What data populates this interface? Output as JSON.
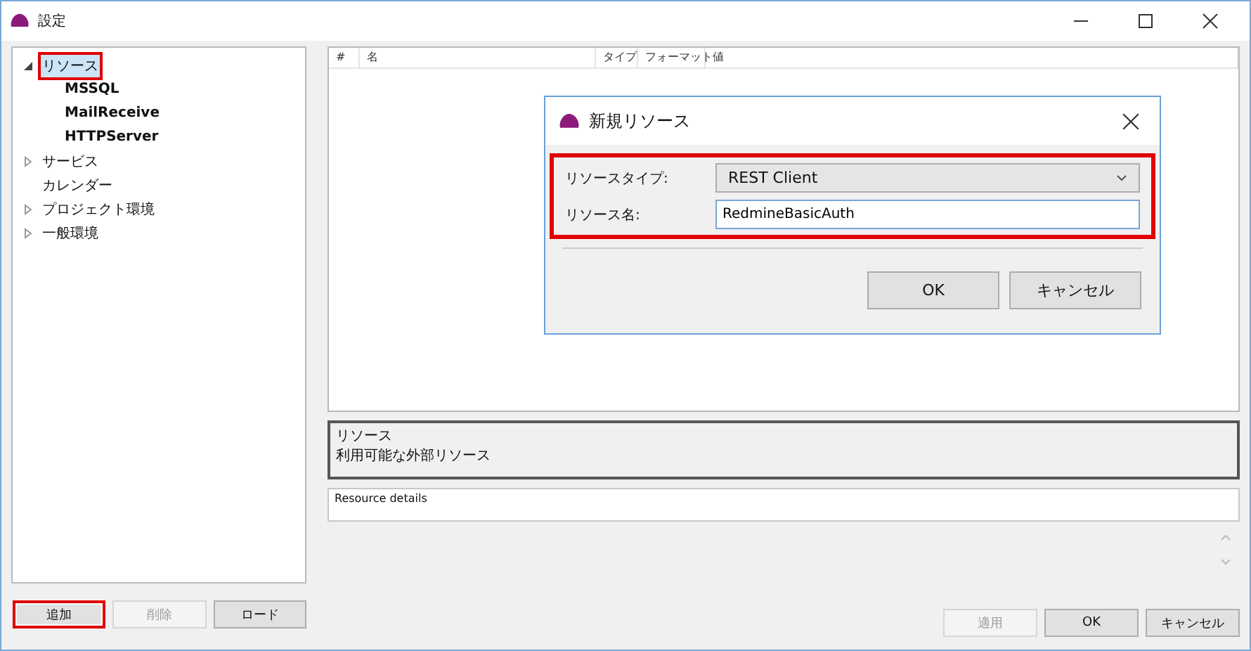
{
  "window": {
    "title": "設定"
  },
  "tree": [
    {
      "label": "リソース",
      "expanded": true,
      "selected": true,
      "highlighted": true,
      "children": [
        {
          "label": "MSSQL"
        },
        {
          "label": "MailReceive"
        },
        {
          "label": "HTTPServer"
        }
      ]
    },
    {
      "label": "サービス",
      "expanded": false,
      "selected": false,
      "highlighted": false
    },
    {
      "label": "カレンダー",
      "selected": false,
      "highlighted": false
    },
    {
      "label": "プロジェクト環境",
      "expanded": false,
      "selected": false,
      "highlighted": false
    },
    {
      "label": "一般環境",
      "expanded": false,
      "selected": false,
      "highlighted": false
    }
  ],
  "left_buttons": [
    {
      "label": "追加",
      "disabled": false,
      "highlighted": true
    },
    {
      "label": "削除",
      "disabled": true,
      "highlighted": false
    },
    {
      "label": "ロード",
      "disabled": false,
      "highlighted": false
    }
  ],
  "table": {
    "columns": [
      "#",
      "名",
      "タイプ",
      "フォーマット",
      "値"
    ]
  },
  "description": {
    "title": "リソース",
    "text": "利用可能な外部リソース"
  },
  "details": {
    "placeholder": "Resource details"
  },
  "bottom_buttons": [
    {
      "label": "適用",
      "disabled": true
    },
    {
      "label": "OK",
      "disabled": false
    },
    {
      "label": "キャンセル",
      "disabled": false
    }
  ],
  "dialog": {
    "title": "新規リソース",
    "highlighted": true,
    "type_label": "リソースタイプ:",
    "type_value": "REST Client",
    "name_label": "リソース名:",
    "name_value": "RedmineBasicAuth",
    "buttons": [
      "OK",
      "キャンセル"
    ]
  }
}
